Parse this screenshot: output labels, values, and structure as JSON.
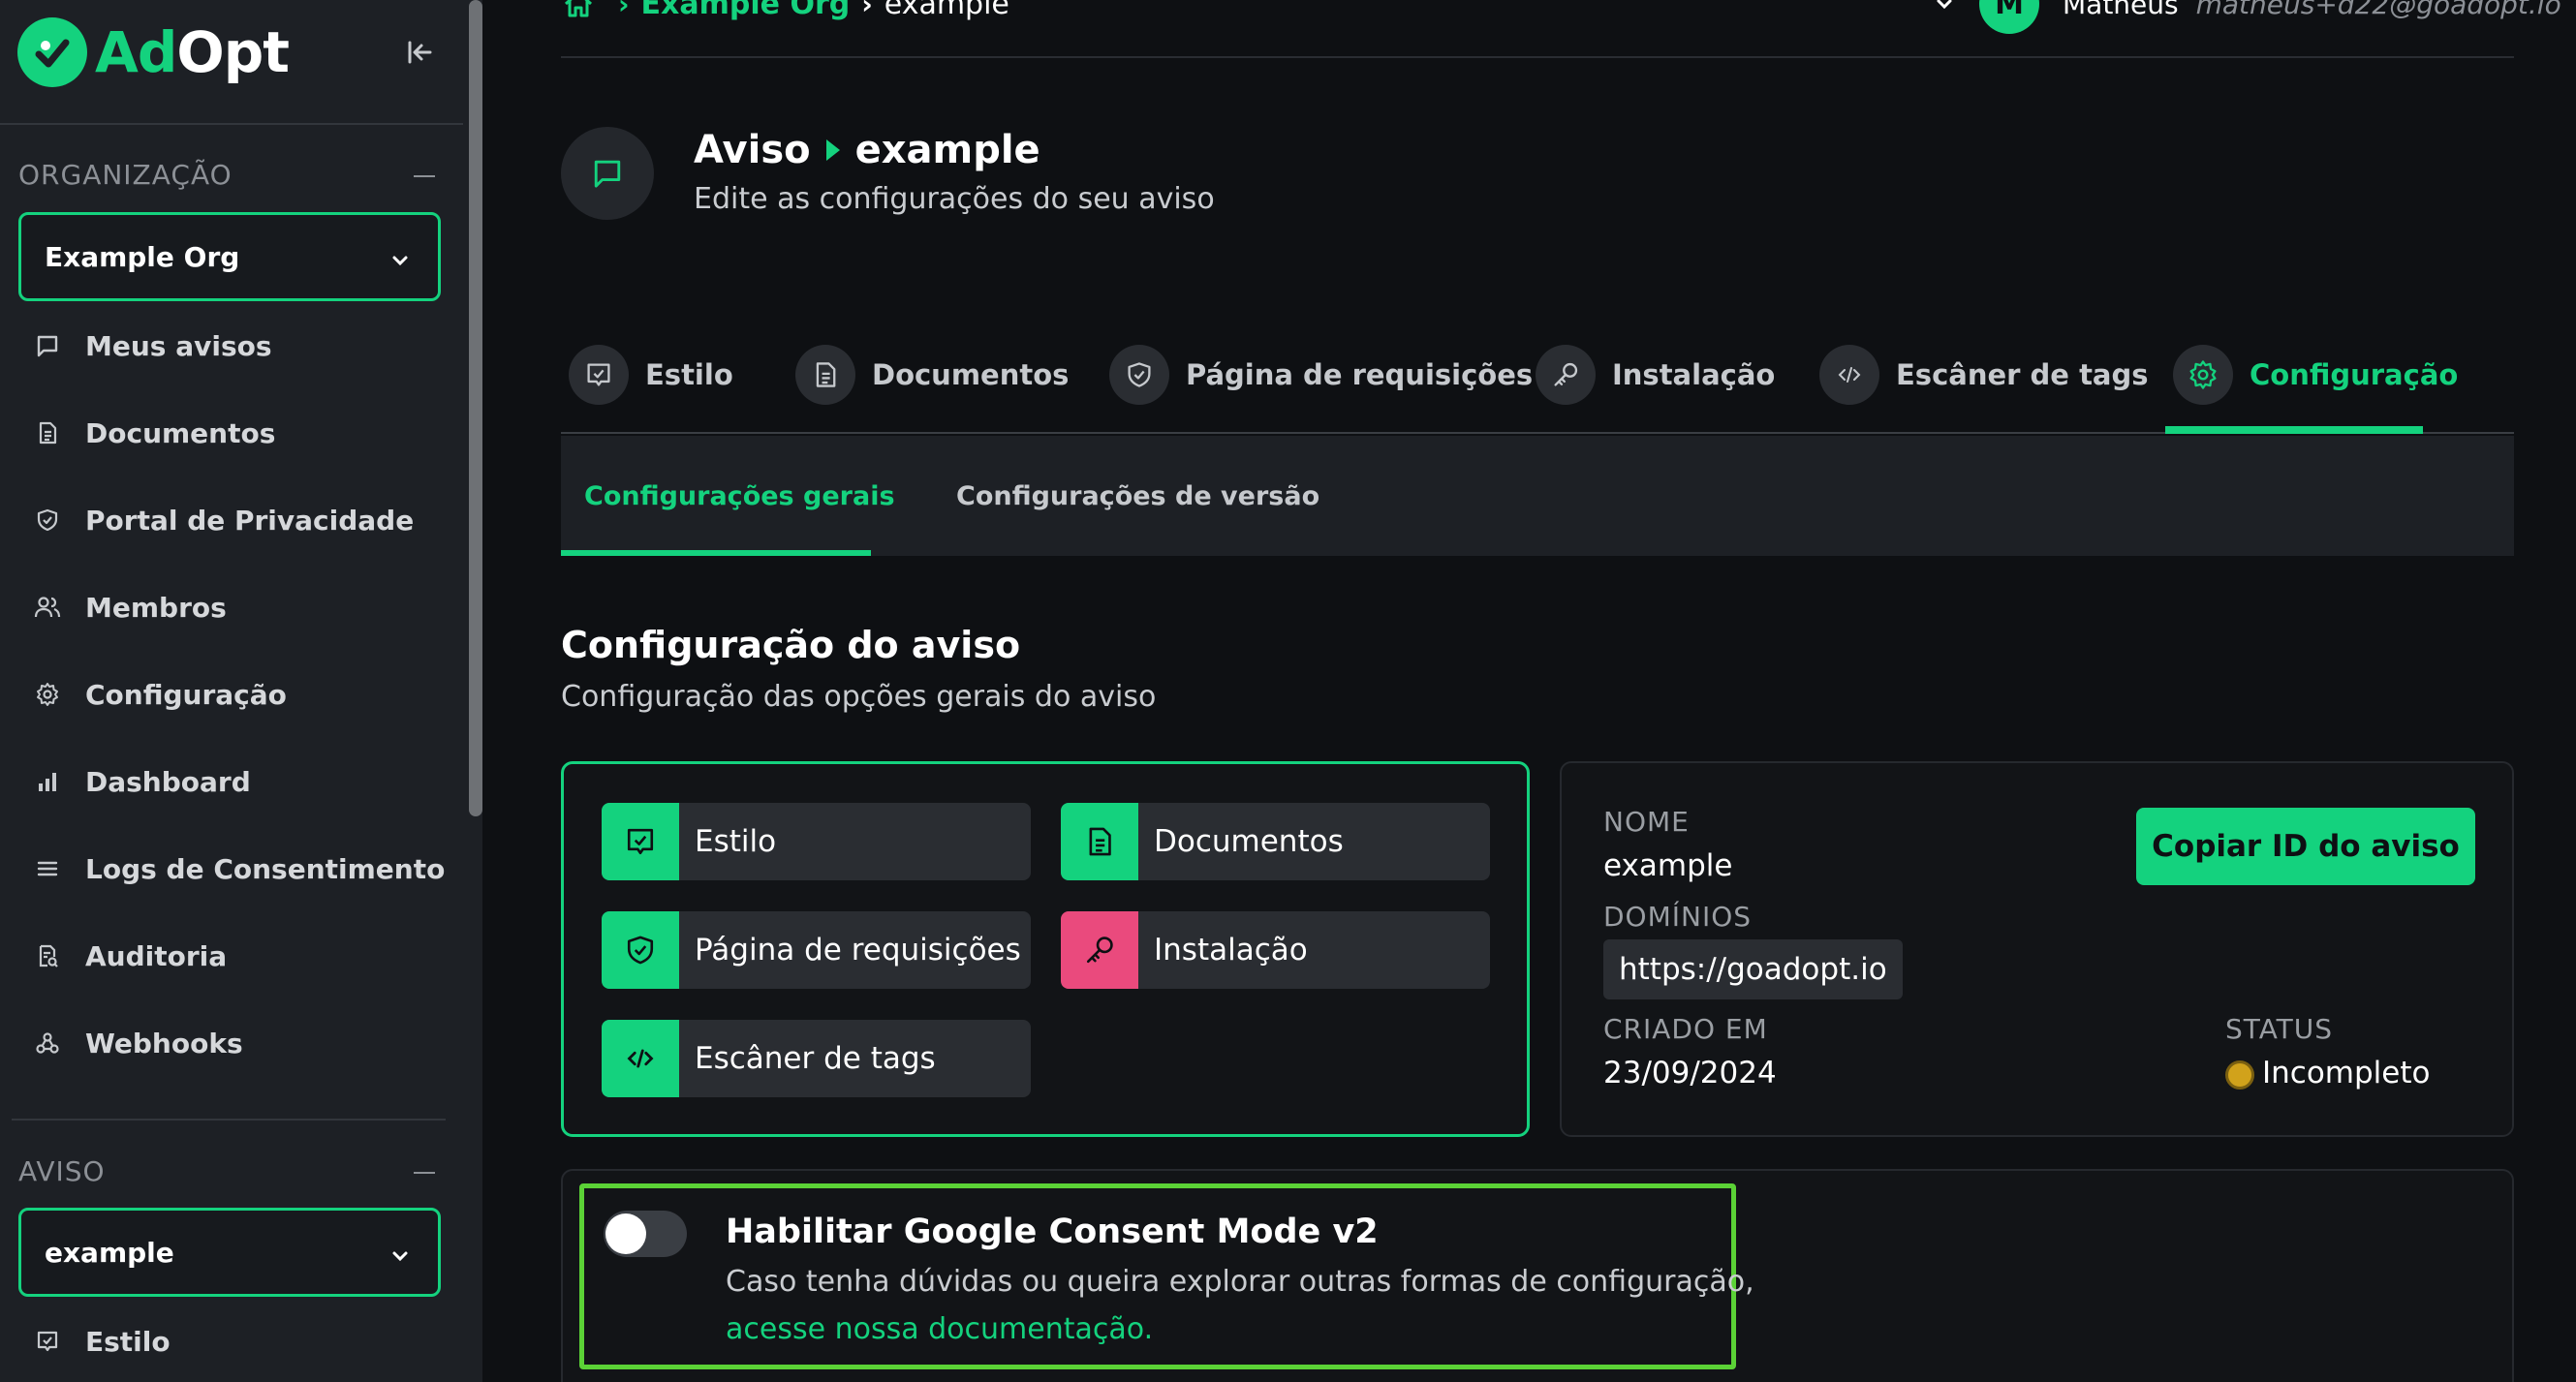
{
  "brand": {
    "name_prefix": "Ad",
    "name_suffix": "Opt",
    "accent": "#14d27e",
    "pink": "#ea4a7d"
  },
  "sidebar": {
    "org_section_label": "ORGANIZAÇÃO",
    "org_select_value": "Example Org",
    "org_items": [
      {
        "label": "Meus avisos",
        "icon": "message-square-icon"
      },
      {
        "label": "Documentos",
        "icon": "document-icon"
      },
      {
        "label": "Portal de Privacidade",
        "icon": "shield-icon"
      },
      {
        "label": "Membros",
        "icon": "users-icon"
      },
      {
        "label": "Configuração",
        "icon": "gear-icon"
      },
      {
        "label": "Dashboard",
        "icon": "bar-chart-icon"
      },
      {
        "label": "Logs de Consentimento",
        "icon": "list-icon"
      },
      {
        "label": "Auditoria",
        "icon": "audit-icon"
      },
      {
        "label": "Webhooks",
        "icon": "webhook-icon"
      }
    ],
    "notice_section_label": "AVISO",
    "notice_select_value": "example",
    "notice_items": [
      {
        "label": "Estilo",
        "icon": "style-icon"
      }
    ]
  },
  "header": {
    "breadcrumb_org": "Example Org",
    "breadcrumb_current": "example",
    "user_initial": "M",
    "user_name": "Matheus",
    "user_email": "matheus+d22@goadopt.io"
  },
  "page": {
    "title_prefix": "Aviso",
    "title_name": "example",
    "subtitle": "Edite as configurações do seu aviso"
  },
  "tabs": [
    {
      "label": "Estilo",
      "icon": "style-icon"
    },
    {
      "label": "Documentos",
      "icon": "document-icon"
    },
    {
      "label": "Página de requisições",
      "icon": "shield-icon"
    },
    {
      "label": "Instalação",
      "icon": "key-icon"
    },
    {
      "label": "Escâner de tags",
      "icon": "code-icon"
    },
    {
      "label": "Configuração",
      "icon": "gear-icon",
      "active": true
    }
  ],
  "subtabs": [
    {
      "label": "Configurações gerais",
      "active": true
    },
    {
      "label": "Configurações de versão"
    }
  ],
  "config": {
    "title": "Configuração do aviso",
    "subtitle": "Configuração das opções gerais do aviso"
  },
  "quick_links": [
    {
      "label": "Estilo",
      "icon": "style-icon"
    },
    {
      "label": "Documentos",
      "icon": "document-icon"
    },
    {
      "label": "Página de requisições",
      "icon": "shield-icon"
    },
    {
      "label": "Instalação",
      "icon": "key-icon"
    },
    {
      "label": "Escâner de tags",
      "icon": "code-icon"
    }
  ],
  "info": {
    "name_label": "NOME",
    "name_value": "example",
    "domains_label": "DOMÍNIOS",
    "domain_value": "https://goadopt.io",
    "created_label": "CRIADO EM",
    "created_value": "23/09/2024",
    "status_label": "STATUS",
    "status_value": "Incompleto",
    "status_color": "#d1a21b",
    "copy_button": "Copiar ID do aviso"
  },
  "gcm": {
    "title": "Habilitar Google Consent Mode v2",
    "description": "Caso tenha dúvidas ou queira explorar outras formas de configuração,",
    "link": "acesse nossa documentação.",
    "enabled": false
  }
}
